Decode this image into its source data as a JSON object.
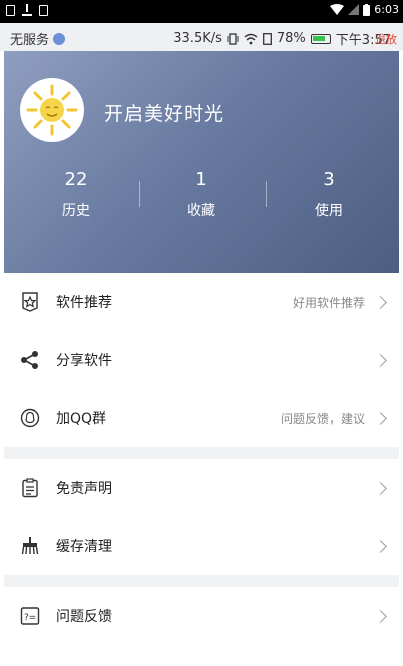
{
  "system_bar": {
    "time": "6:03",
    "icons": [
      "image-icon",
      "download-icon",
      "calendar-icon",
      "wifi-icon",
      "signal-icon",
      "battery-icon"
    ]
  },
  "status_bar": {
    "carrier": "无服务",
    "speed": "33.5K/s",
    "battery": "78%",
    "time_text": "下午3:57",
    "overlay": "退放"
  },
  "profile": {
    "title": "开启美好时光",
    "avatar_icon": "sun-icon",
    "stats": [
      {
        "value": "22",
        "label": "历史"
      },
      {
        "value": "1",
        "label": "收藏"
      },
      {
        "value": "3",
        "label": "使用"
      }
    ]
  },
  "menu": {
    "items": [
      {
        "label": "软件推荐",
        "hint": "好用软件推荐",
        "icon": "star-frame-icon"
      },
      {
        "label": "分享软件",
        "hint": "",
        "icon": "share-icon"
      },
      {
        "label": "加QQ群",
        "hint": "问题反馈，建议",
        "icon": "qq-icon"
      },
      {
        "label": "免责声明",
        "hint": "",
        "icon": "document-icon"
      },
      {
        "label": "缓存清理",
        "hint": "",
        "icon": "broom-icon"
      },
      {
        "label": "问题反馈",
        "hint": "",
        "icon": "feedback-icon"
      }
    ]
  },
  "colors": {
    "header_start": "#8f9ec0",
    "header_end": "#4d5d82",
    "separator": "#f1f2f4"
  }
}
